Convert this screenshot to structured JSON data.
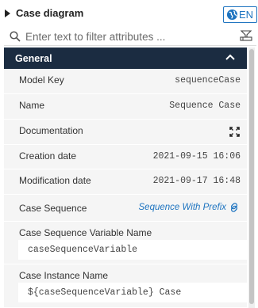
{
  "header": {
    "title": "Case diagram",
    "language": "EN"
  },
  "filter": {
    "placeholder": "Enter text to filter attributes ..."
  },
  "group": {
    "label": "General"
  },
  "properties": {
    "model_key": {
      "label": "Model Key",
      "value": "sequenceCase"
    },
    "name": {
      "label": "Name",
      "value": "Sequence Case"
    },
    "documentation": {
      "label": "Documentation"
    },
    "creation_date": {
      "label": "Creation date",
      "value": "2021-09-15 16:06"
    },
    "modification_date": {
      "label": "Modification date",
      "value": "2021-09-17 16:48"
    },
    "case_sequence": {
      "label": "Case Sequence",
      "value": "Sequence With Prefix"
    },
    "sequence_variable_name": {
      "label": "Case Sequence Variable Name",
      "value": "caseSequenceVariable"
    },
    "case_instance_name": {
      "label": "Case Instance Name",
      "value": "${caseSequenceVariable} Case"
    }
  },
  "colors": {
    "accent": "#1e74c0",
    "group_header_bg": "#1b2c41",
    "panel_bg": "#f5f5f5"
  },
  "icons": [
    "caret-right-icon",
    "globe-icon",
    "search-icon",
    "clear-filter-icon",
    "chevron-up-icon",
    "expand-icon",
    "link-icon"
  ]
}
